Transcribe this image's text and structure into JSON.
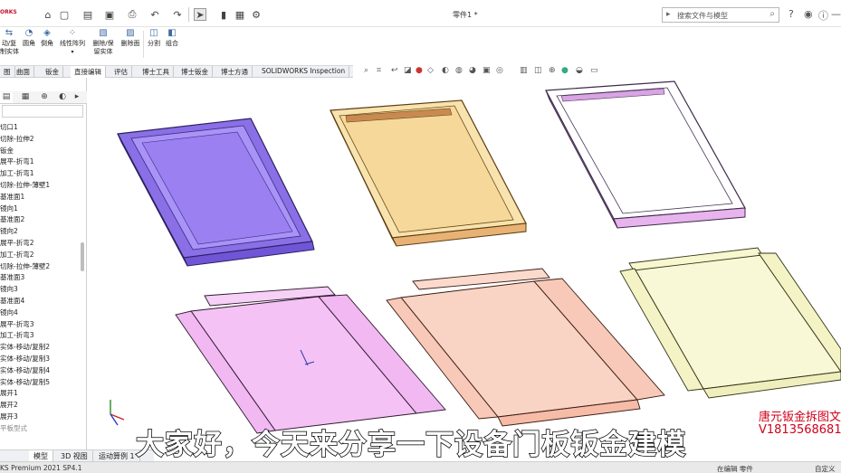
{
  "app": {
    "logo_text": "ORKS",
    "doc_title": "零件1 *",
    "search_placeholder": "搜索文件与模型"
  },
  "ribbon": {
    "buttons": [
      {
        "label": "动/复\n制实体",
        "icon": "move-copy-icon"
      },
      {
        "label": "圆角",
        "icon": "fillet-icon"
      },
      {
        "label": "倒角",
        "icon": "chamfer-icon"
      },
      {
        "label": "线性阵列",
        "icon": "linear-pattern-icon"
      },
      {
        "label": "删除/保\n留实体",
        "icon": "delete-body-icon"
      },
      {
        "label": "删除面",
        "icon": "delete-face-icon"
      },
      {
        "label": "分割",
        "icon": "split-icon"
      },
      {
        "label": "组合",
        "icon": "combine-icon"
      }
    ]
  },
  "tabs": [
    {
      "label": "图",
      "active": false
    },
    {
      "label": "曲面",
      "active": false
    },
    {
      "label": "钣金",
      "active": false
    },
    {
      "label": "直接编辑",
      "active": true
    },
    {
      "label": "评估",
      "active": false
    },
    {
      "label": "博士工具",
      "active": false
    },
    {
      "label": "博士钣金",
      "active": false
    },
    {
      "label": "博士方通",
      "active": false
    },
    {
      "label": "SOLIDWORKS Inspection",
      "active": false
    }
  ],
  "tree": [
    {
      "label": "切口1"
    },
    {
      "label": "切除-拉伸2"
    },
    {
      "label": "钣金"
    },
    {
      "label": "展平-折弯1"
    },
    {
      "label": "加工-折弯1"
    },
    {
      "label": "切除-拉伸-薄壁1"
    },
    {
      "label": "基准面1"
    },
    {
      "label": "镜向1"
    },
    {
      "label": "基准面2"
    },
    {
      "label": "镜向2"
    },
    {
      "label": "展平-折弯2"
    },
    {
      "label": "加工-折弯2"
    },
    {
      "label": "切除-拉伸-薄壁2"
    },
    {
      "label": "基准面3"
    },
    {
      "label": "镜向3"
    },
    {
      "label": "基准面4"
    },
    {
      "label": "镜向4"
    },
    {
      "label": "展平-折弯3"
    },
    {
      "label": "加工-折弯3"
    },
    {
      "label": "实体-移动/复制2"
    },
    {
      "label": "实体-移动/复制3"
    },
    {
      "label": "实体-移动/复制4"
    },
    {
      "label": "实体-移动/复制5"
    },
    {
      "label": "展开1"
    },
    {
      "label": "展开2"
    },
    {
      "label": "展开3"
    },
    {
      "label": "平板型式",
      "grey": true
    }
  ],
  "bottom_tabs": [
    {
      "label": "模型",
      "active": true
    },
    {
      "label": "3D 视图",
      "active": false
    },
    {
      "label": "运动算例 1",
      "active": false
    }
  ],
  "status": {
    "left": "KS Premium 2021 SP4.1",
    "middle": "在编辑 零件",
    "right": "自定义"
  },
  "overlay": {
    "subtitle": "大家好，今天来分享一下设备门板钣金建模",
    "watermark_line1": "唐元钣金拆图文",
    "watermark_line2": "V1813568681"
  },
  "colors": {
    "purple_panel": "#9b7ff0",
    "orange_panel": "#f5d79b",
    "white_panel": "#ffffff",
    "pink_flat": "#f2b8f2",
    "salmon_flat": "#f8c9b8",
    "cream_flat": "#f7f7d0",
    "watermark": "#d0021b"
  }
}
